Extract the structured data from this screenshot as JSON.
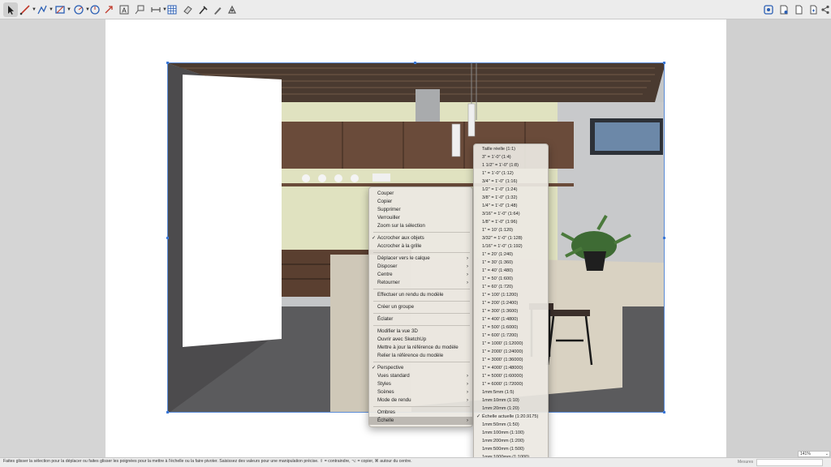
{
  "toolbar": {
    "left_tools": [
      "select-icon",
      "line-icon",
      "freehand-icon",
      "rectangle-icon",
      "circle-icon",
      "rotate-icon",
      "scale-icon",
      "text-icon",
      "label-icon",
      "dimension-icon",
      "table-icon",
      "eraser-icon",
      "eyedropper-icon",
      "pen-icon",
      "split-icon"
    ],
    "right_tools": [
      "sketchup-icon",
      "doc-settings-icon",
      "page-icon",
      "page-add-icon",
      "page-remove-icon",
      "share-icon"
    ]
  },
  "statusbar": {
    "text": "Faites glisser la sélection pour la déplacer ou faites glisser les poignées pour la mettre à l'échelle ou la faire pivoter. Saisissez des valeurs pour une manipulation précise. ⇧ = contraindre, ⌥ = copier, ⌘ autour du centre.",
    "measurements_label": "Mesures",
    "zoom": "141%"
  },
  "context_menu": {
    "items": [
      {
        "label": "Couper",
        "check": "",
        "submenu": false
      },
      {
        "label": "Copier",
        "check": "",
        "submenu": false
      },
      {
        "label": "Supprimer",
        "check": "",
        "submenu": false
      },
      {
        "label": "Verrouiller",
        "check": "",
        "submenu": false
      },
      {
        "label": "Zoom sur la sélection",
        "check": "",
        "submenu": false
      },
      {
        "label": "Accrocher aux objets",
        "check": "✓",
        "submenu": false
      },
      {
        "label": "Accrocher à la grille",
        "check": "",
        "submenu": false
      },
      {
        "label": "Déplacer vers le calque",
        "check": "",
        "submenu": true
      },
      {
        "label": "Disposer",
        "check": "",
        "submenu": true
      },
      {
        "label": "Centre",
        "check": "",
        "submenu": true
      },
      {
        "label": "Retourner",
        "check": "",
        "submenu": true
      },
      {
        "label": "Effectuer un rendu du modèle",
        "check": "",
        "submenu": false
      },
      {
        "label": "Créer un groupe",
        "check": "",
        "submenu": false
      },
      {
        "label": "Éclater",
        "check": "",
        "submenu": false
      },
      {
        "label": "Modifier la vue 3D",
        "check": "",
        "submenu": false
      },
      {
        "label": "Ouvrir avec SketchUp",
        "check": "",
        "submenu": false
      },
      {
        "label": "Mettre à jour la référence du modèle",
        "check": "",
        "submenu": false
      },
      {
        "label": "Relier la référence du modèle",
        "check": "",
        "submenu": false
      },
      {
        "label": "Perspective",
        "check": "✓",
        "submenu": false
      },
      {
        "label": "Vues standard",
        "check": "",
        "submenu": true
      },
      {
        "label": "Styles",
        "check": "",
        "submenu": true
      },
      {
        "label": "Scènes",
        "check": "",
        "submenu": true
      },
      {
        "label": "Mode de rendu",
        "check": "",
        "submenu": true
      },
      {
        "label": "Ombres",
        "check": "",
        "submenu": false
      },
      {
        "label": "Échelle",
        "check": "",
        "submenu": true
      }
    ],
    "highlighted": "Échelle"
  },
  "scale_submenu": {
    "items": [
      {
        "label": "Taille réelle (1:1)",
        "check": ""
      },
      {
        "label": "3\" = 1'-0\" (1:4)",
        "check": ""
      },
      {
        "label": "1 1/2\" = 1'-0\" (1:8)",
        "check": ""
      },
      {
        "label": "1\" = 1'-0\" (1:12)",
        "check": ""
      },
      {
        "label": "3/4\" = 1'-0\" (1:16)",
        "check": ""
      },
      {
        "label": "1/2\" = 1'-0\" (1:24)",
        "check": ""
      },
      {
        "label": "3/8\" = 1'-0\" (1:32)",
        "check": ""
      },
      {
        "label": "1/4\" = 1'-0\" (1:48)",
        "check": ""
      },
      {
        "label": "3/16\" = 1'-0\" (1:64)",
        "check": ""
      },
      {
        "label": "1/8\" = 1'-0\" (1:96)",
        "check": ""
      },
      {
        "label": "1\" = 10' (1:120)",
        "check": ""
      },
      {
        "label": "3/32\" = 1'-0\" (1:128)",
        "check": ""
      },
      {
        "label": "1/16\" = 1'-0\" (1:192)",
        "check": ""
      },
      {
        "label": "1\" = 20' (1:240)",
        "check": ""
      },
      {
        "label": "1\" = 30' (1:360)",
        "check": ""
      },
      {
        "label": "1\" = 40' (1:480)",
        "check": ""
      },
      {
        "label": "1\" = 50' (1:600)",
        "check": ""
      },
      {
        "label": "1\" = 60' (1:720)",
        "check": ""
      },
      {
        "label": "1\" = 100' (1:1200)",
        "check": ""
      },
      {
        "label": "1\" = 200' (1:2400)",
        "check": ""
      },
      {
        "label": "1\" = 300' (1:3600)",
        "check": ""
      },
      {
        "label": "1\" = 400' (1:4800)",
        "check": ""
      },
      {
        "label": "1\" = 500' (1:6000)",
        "check": ""
      },
      {
        "label": "1\" = 600' (1:7200)",
        "check": ""
      },
      {
        "label": "1\" = 1000' (1:12000)",
        "check": ""
      },
      {
        "label": "1\" = 2000' (1:24000)",
        "check": ""
      },
      {
        "label": "1\" = 3000' (1:36000)",
        "check": ""
      },
      {
        "label": "1\" = 4000' (1:48000)",
        "check": ""
      },
      {
        "label": "1\" = 5000' (1:60000)",
        "check": ""
      },
      {
        "label": "1\" = 6000' (1:72000)",
        "check": ""
      },
      {
        "label": "1mm:5mm (1:5)",
        "check": ""
      },
      {
        "label": "1mm:10mm (1:10)",
        "check": ""
      },
      {
        "label": "1mm:20mm (1:20)",
        "check": ""
      },
      {
        "label": "Échelle actuelle (1:20.9175)",
        "check": "✓"
      },
      {
        "label": "1mm:50mm (1:50)",
        "check": ""
      },
      {
        "label": "1mm:100mm (1:100)",
        "check": ""
      },
      {
        "label": "1mm:200mm (1:200)",
        "check": ""
      },
      {
        "label": "1mm:500mm (1:500)",
        "check": ""
      },
      {
        "label": "1mm:1000mm (1:1000)",
        "check": ""
      }
    ]
  },
  "colors": {
    "selection": "#3b78d8",
    "wall": "#e0e2c0",
    "wood": "#6a4b3a"
  }
}
